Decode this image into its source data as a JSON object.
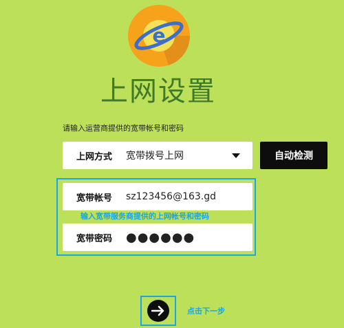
{
  "page": {
    "title": "上网设置"
  },
  "hint": "请输入运营商提供的宽带帐号和密码",
  "method": {
    "label": "上网方式",
    "value": "宽带拨号上网"
  },
  "auto_detect_label": "自动检测",
  "account": {
    "label": "宽带帐号",
    "value": "sz123456@163.gd"
  },
  "password": {
    "label": "宽带密码",
    "value": "●●●●●●"
  },
  "annotation": "输入宽带服务商提供的上网帐号和密码",
  "next": {
    "label": "点击下一步"
  },
  "colors": {
    "background": "#bde05a",
    "title": "#3e7a2a",
    "accent": "#1aa6e0",
    "button": "#0d0d0d"
  }
}
